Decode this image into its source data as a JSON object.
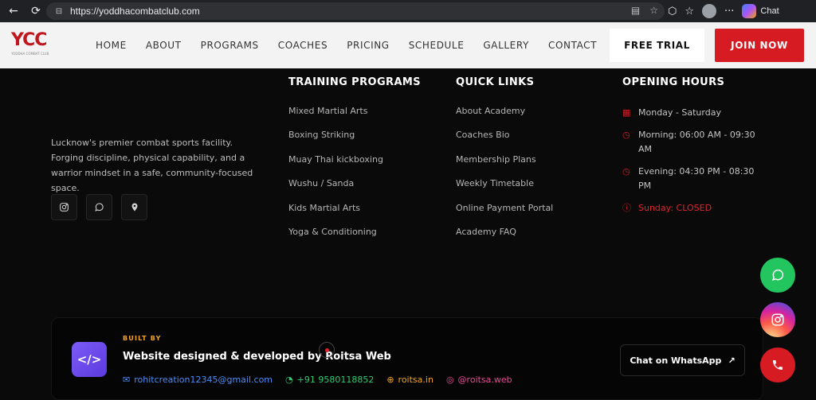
{
  "browser": {
    "url": "https://yoddhacombatclub.com",
    "copilot_label": "Chat"
  },
  "header": {
    "logo_text": "YCC",
    "logo_sub": "YODDHA COMBAT CLUB",
    "nav": [
      "HOME",
      "ABOUT",
      "PROGRAMS",
      "COACHES",
      "PRICING",
      "SCHEDULE",
      "GALLERY",
      "CONTACT"
    ],
    "free_trial_label": "FREE TRIAL",
    "join_now_label": "JOIN NOW",
    "accent_color": "#d71b23"
  },
  "about": {
    "text": "Lucknow's premier combat sports facility. Forging discipline, physical capability, and a warrior mindset in a safe, community-focused space.",
    "socials": [
      "instagram-icon",
      "whatsapp-icon",
      "location-pin-icon"
    ]
  },
  "programs": {
    "heading": "TRAINING PROGRAMS",
    "items": [
      "Mixed Martial Arts",
      "Boxing Striking",
      "Muay Thai kickboxing",
      "Wushu / Sanda",
      "Kids Martial Arts",
      "Yoga & Conditioning"
    ]
  },
  "quick_links": {
    "heading": "QUICK LINKS",
    "items": [
      "About Academy",
      "Coaches Bio",
      "Membership Plans",
      "Weekly Timetable",
      "Online Payment Portal",
      "Academy FAQ"
    ]
  },
  "hours": {
    "heading": "OPENING HOURS",
    "days": "Monday - Saturday",
    "morning": "Morning: 06:00 AM - 09:30 AM",
    "evening": "Evening: 04:30 PM - 08:30 PM",
    "closed": "Sunday: CLOSED"
  },
  "built_by": {
    "label": "BUILT BY",
    "title": "Website designed & developed by Roitsa Web",
    "email": "rohitcreation12345@gmail.com",
    "phone": "+91 9580118852",
    "website": "roitsa.in",
    "instagram": "@roitsa.web",
    "chat_label": "Chat on WhatsApp"
  }
}
